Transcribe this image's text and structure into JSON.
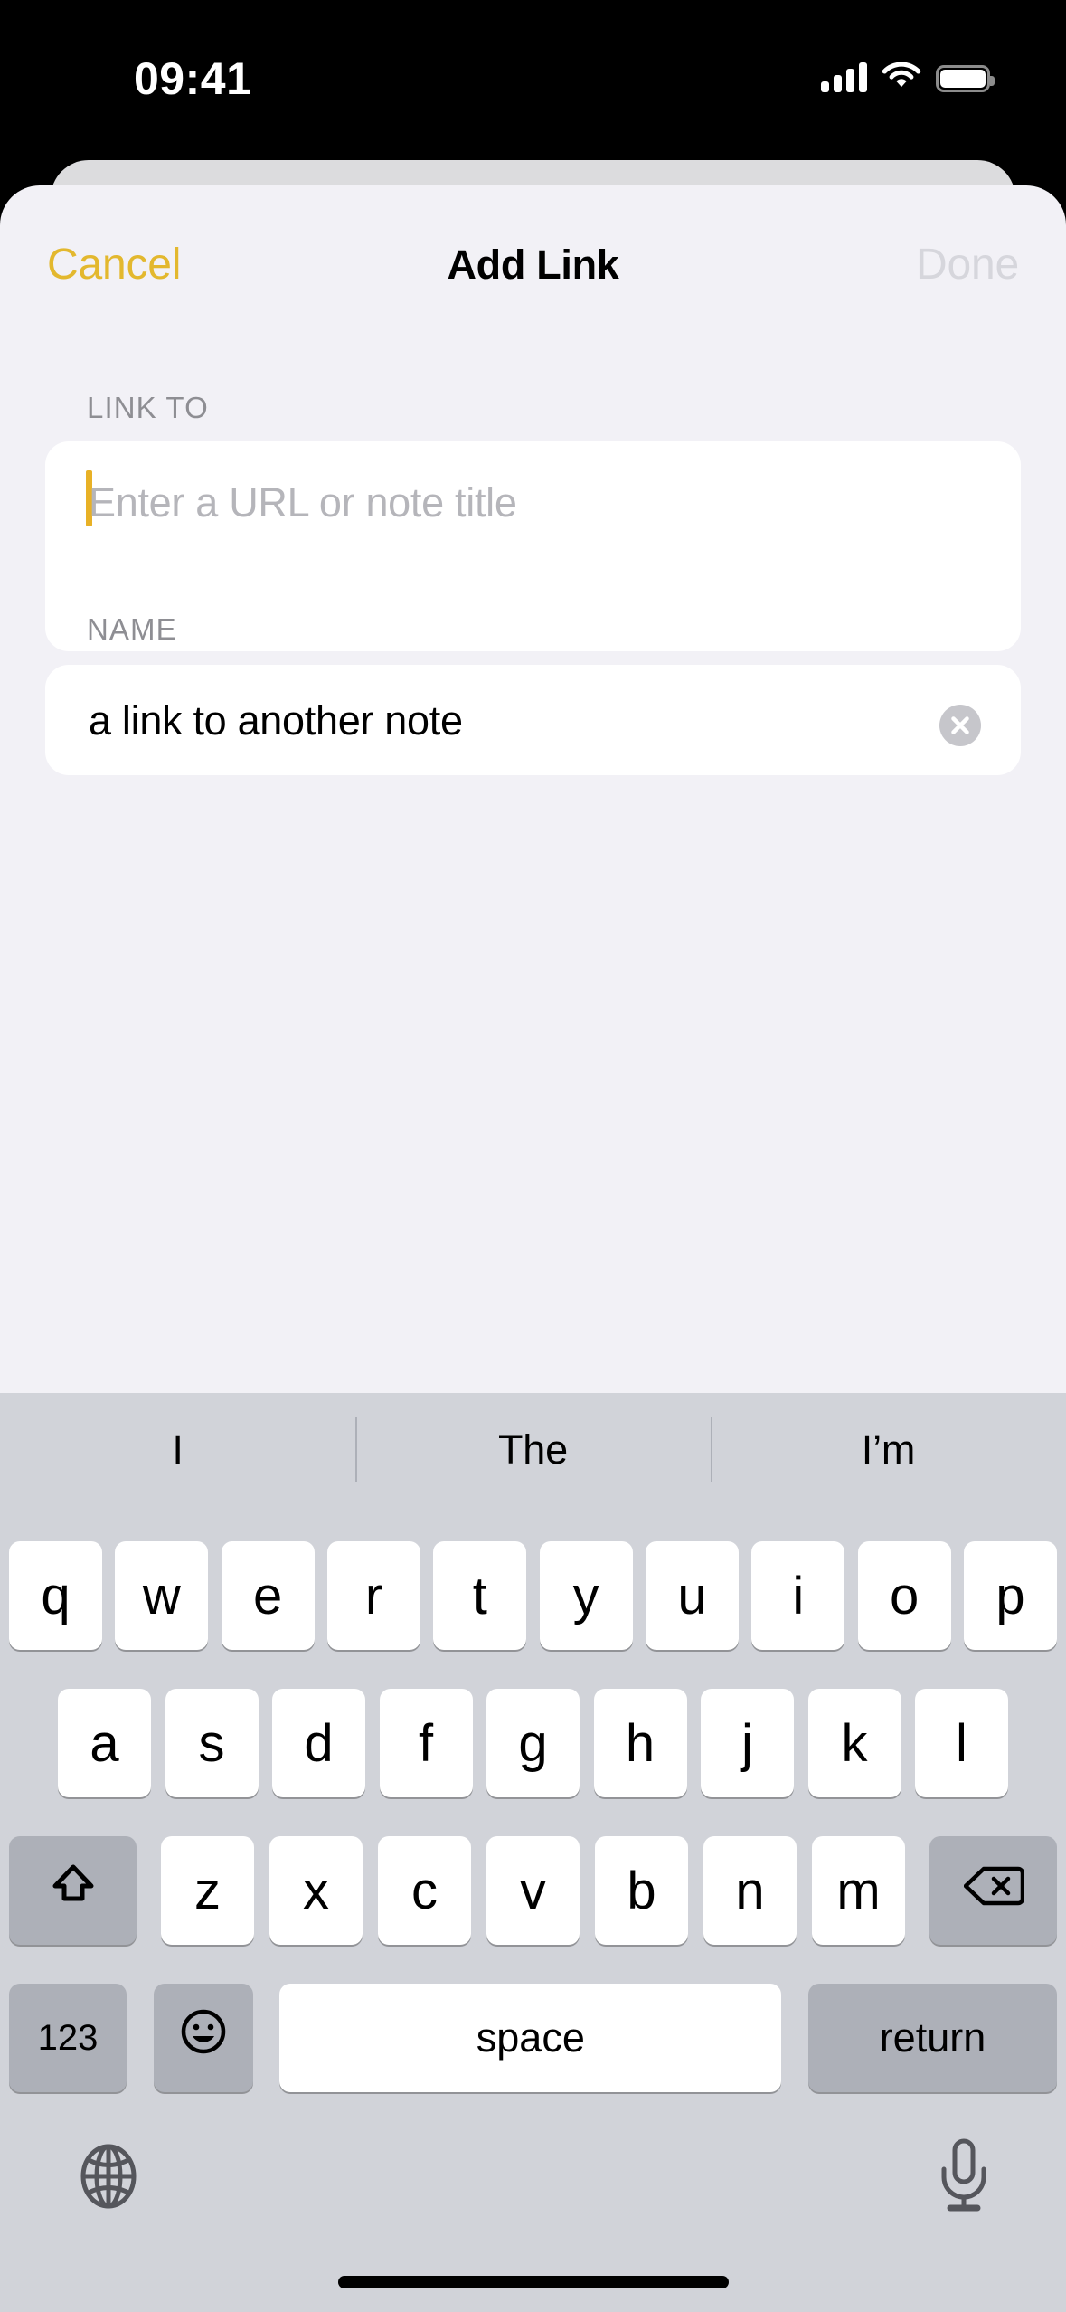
{
  "status_bar": {
    "time": "09:41",
    "cellular_icon": "signal-bars-icon",
    "cellular_bars": 4,
    "wifi_icon": "wifi-icon",
    "battery_icon": "battery-full-icon"
  },
  "nav_bar": {
    "cancel_label": "Cancel",
    "title": "Add Link",
    "done_label": "Done",
    "cancel_color": "#e3b82e",
    "done_color": "#d6d6dc",
    "done_enabled": false
  },
  "form": {
    "link_to": {
      "section_label": "LINK TO",
      "placeholder": "Enter a URL or note title",
      "value": "",
      "focused": true,
      "caret_color": "#e8b126"
    },
    "name": {
      "section_label": "NAME",
      "value": "a link to another note",
      "clear_icon": "clear-circle-icon"
    }
  },
  "keyboard": {
    "suggestions": [
      "I",
      "The",
      "I’m"
    ],
    "row1": [
      "q",
      "w",
      "e",
      "r",
      "t",
      "y",
      "u",
      "i",
      "o",
      "p"
    ],
    "row2": [
      "a",
      "s",
      "d",
      "f",
      "g",
      "h",
      "j",
      "k",
      "l"
    ],
    "row3_letters": [
      "z",
      "x",
      "c",
      "v",
      "b",
      "n",
      "m"
    ],
    "shift_icon": "shift-arrow-icon",
    "backspace_icon": "backspace-delete-icon",
    "numbers_label": "123",
    "emoji_icon": "emoji-smiley-icon",
    "space_label": "space",
    "return_label": "return",
    "globe_icon": "globe-language-icon",
    "mic_icon": "microphone-dictation-icon",
    "background_color": "#d1d3d9",
    "key_color": "#ffffff",
    "modifier_key_color": "#adb0b8"
  },
  "colors": {
    "sheet_background": "#f2f1f6",
    "field_background": "#ffffff",
    "accent": "#e3b82e",
    "secondary_text": "#8e8e93"
  }
}
